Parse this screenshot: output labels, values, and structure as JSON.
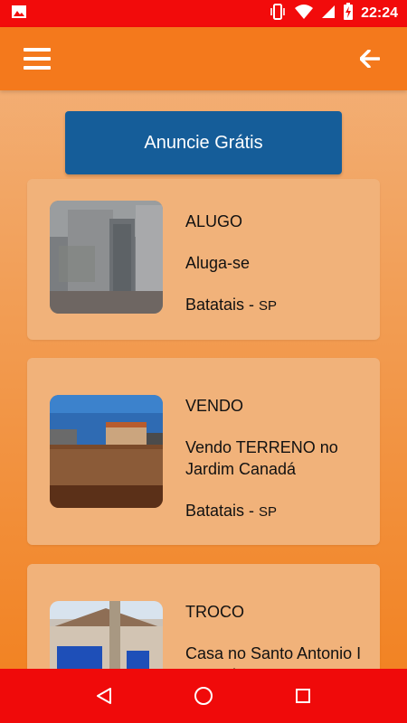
{
  "status_bar": {
    "time": "22:24",
    "icons": [
      "image-icon",
      "vibrate-icon",
      "wifi-icon",
      "signal-icon",
      "battery-charging-icon"
    ]
  },
  "app_bar": {
    "menu_icon": "hamburger-menu-icon",
    "back_icon": "arrow-left-icon"
  },
  "announce_button": {
    "label": "Anuncie Grátis"
  },
  "listings": [
    {
      "type": "ALUGO",
      "title": "Aluga-se",
      "city": "Batatais",
      "state": "SP"
    },
    {
      "type": "VENDO",
      "title": "Vendo TERRENO no Jardim Canadá",
      "city": "Batatais",
      "state": "SP"
    },
    {
      "type": "TROCO",
      "title": "Casa no Santo Antonio I Batatais",
      "city": "",
      "state": ""
    }
  ],
  "nav_bar": {
    "back_icon": "triangle-back-icon",
    "home_icon": "circle-home-icon",
    "recents_icon": "square-recents-icon"
  },
  "colors": {
    "status_bar": "#f20b0b",
    "app_bar": "#f4791c",
    "button": "#155d99",
    "card": "#f1b27a",
    "nav_bar": "#f00a0a"
  }
}
